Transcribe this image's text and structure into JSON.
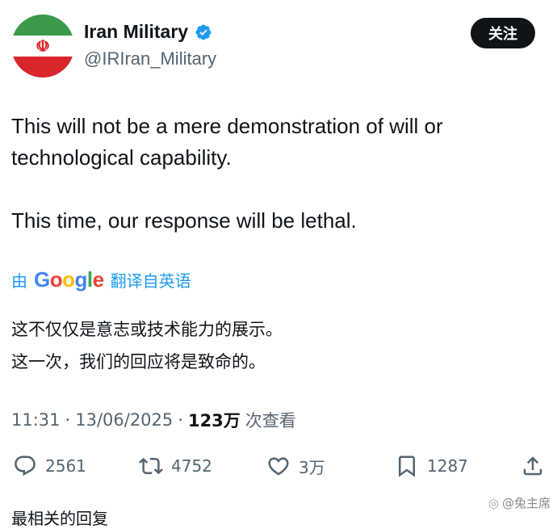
{
  "author": {
    "display_name": "Iran Military",
    "handle": "@IRIran_Military",
    "verified": true
  },
  "follow_button": {
    "label": "关注"
  },
  "tweet": {
    "paragraphs": [
      "This will not be a mere demonstration of will or technological capability.",
      "This time, our response will be lethal."
    ]
  },
  "translation": {
    "prefix": "由",
    "provider": "Google",
    "suffix": "翻译自英语",
    "lines": [
      "这不仅仅是意志或技术能力的展示。",
      "这一次，我们的回应将是致命的。"
    ]
  },
  "meta": {
    "time": "11:31",
    "date": "13/06/2025",
    "separator": "·",
    "views_count": "123万",
    "views_label": "次查看"
  },
  "actions": {
    "replies": "2561",
    "reposts": "4752",
    "likes": "3万",
    "bookmarks": "1287"
  },
  "partial_text": "最相关的回复",
  "watermark": "@兔主席",
  "colors": {
    "text": "#0f1419",
    "secondary": "#536471",
    "link": "#1d9bf0",
    "verified": "#1d9bf0",
    "button_bg": "#0f1419"
  }
}
